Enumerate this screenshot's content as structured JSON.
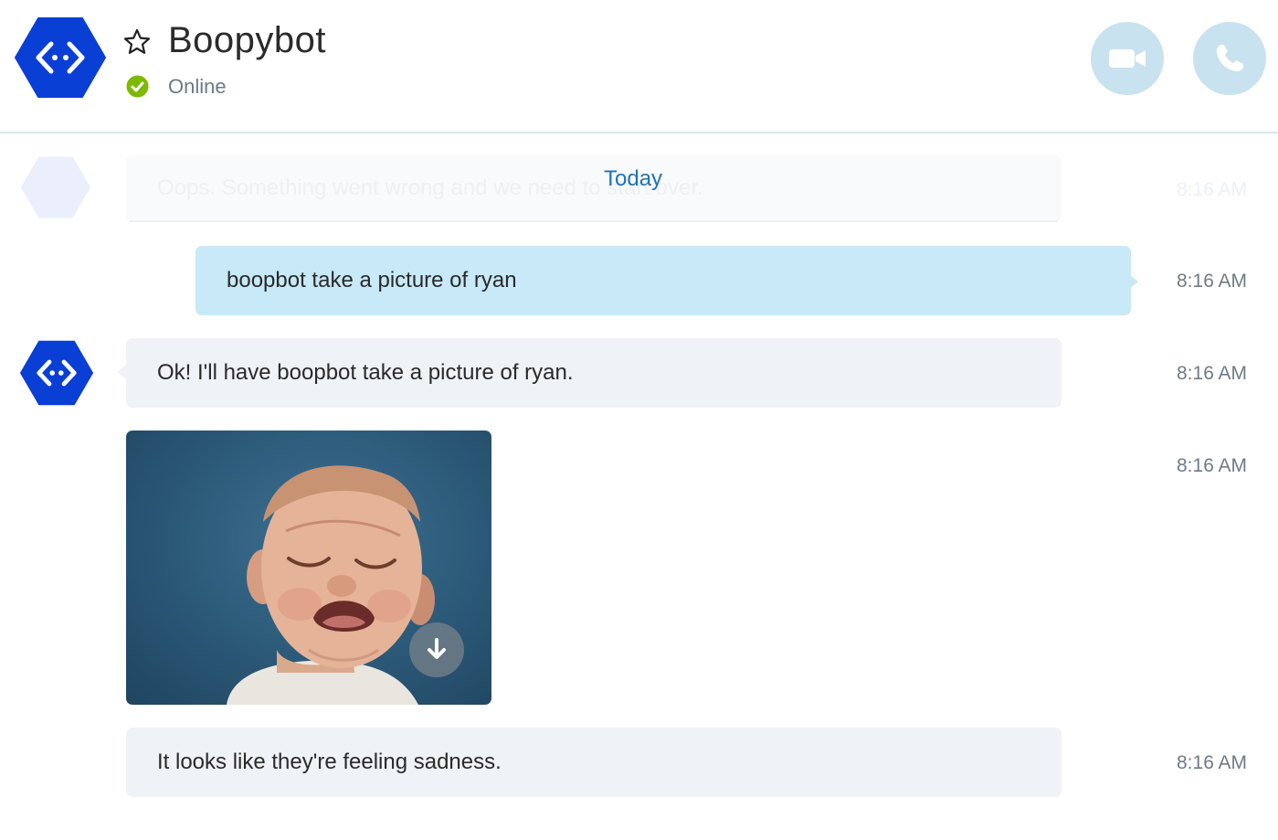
{
  "header": {
    "contact_name": "Boopybot",
    "status": "Online",
    "status_color": "#7cba00",
    "favorite_icon": "star-outline-icon",
    "video_call_icon": "video-camera-icon",
    "audio_call_icon": "phone-icon"
  },
  "conversation": {
    "day_divider": "Today",
    "faded_message": {
      "text": "Oops. Something went wrong and we need to start over.",
      "time": "8:16 AM"
    },
    "messages": [
      {
        "sender": "me",
        "text": "boopbot take a picture of ryan",
        "time": "8:16 AM"
      },
      {
        "sender": "Boopybot",
        "text": "Ok! I'll have boopbot take a picture of ryan.",
        "time": "8:16 AM"
      },
      {
        "sender": "Boopybot",
        "type": "image",
        "image": "photo of crying baby",
        "time": "8:16 AM"
      },
      {
        "sender": "Boopybot",
        "text": "It looks like they're feeling sadness.",
        "time": "8:16 AM"
      }
    ]
  },
  "colors": {
    "brand": "#0a3fd6",
    "outgoing_bubble": "#c7e9f8",
    "incoming_bubble": "#eff2f6",
    "call_button": "#c8e2ef",
    "link": "#1e73b8"
  }
}
